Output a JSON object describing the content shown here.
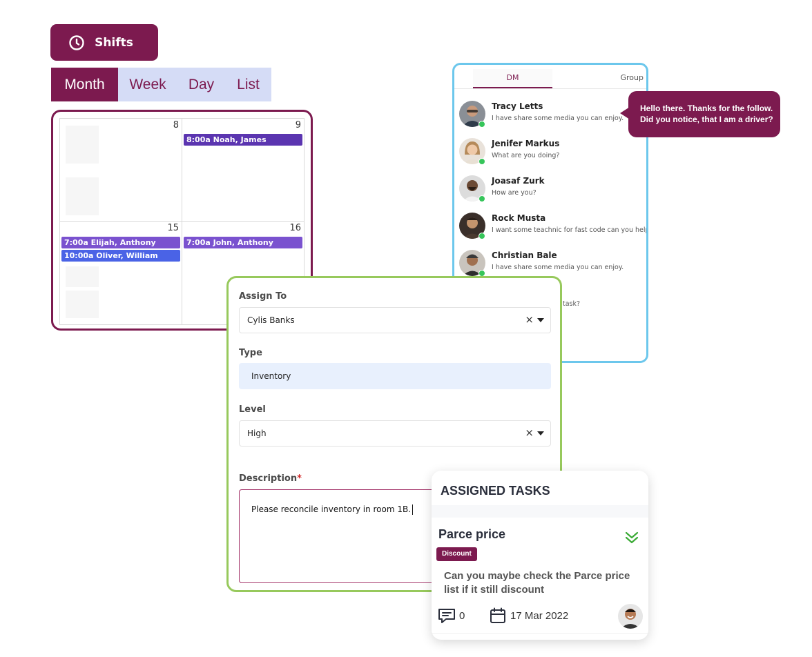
{
  "shifts_button": {
    "label": "Shifts",
    "icon": "clock-icon"
  },
  "view_tabs": [
    {
      "label": "Month",
      "active": true
    },
    {
      "label": "Week",
      "active": false
    },
    {
      "label": "Day",
      "active": false
    },
    {
      "label": "List",
      "active": false
    }
  ],
  "calendar": {
    "days": [
      "8",
      "9",
      "15",
      "16"
    ],
    "events": [
      {
        "label": "8:00a Noah, James",
        "day": "9",
        "color": "#5b35b0"
      },
      {
        "label": "7:00a Elijah, Anthony",
        "day": "15",
        "color": "#7a52cf"
      },
      {
        "label": "10:00a Oliver, William",
        "day": "15",
        "color": "#4a63e6"
      },
      {
        "label": "7:00a John, Anthony",
        "day": "16",
        "color": "#7a52cf"
      }
    ]
  },
  "chat": {
    "tabs": {
      "dm": "DM",
      "group": "Group"
    },
    "contacts": [
      {
        "name": "Tracy Letts",
        "message": "I have share some media you can enjoy."
      },
      {
        "name": "Jenifer Markus",
        "message": "What are you doing?"
      },
      {
        "name": "Joasaf Zurk",
        "message": "How are you?"
      },
      {
        "name": "Rock Musta",
        "message": "I want some teachnic for fast code can you help?"
      },
      {
        "name": "Christian Bale",
        "message": "I have share some media you can enjoy."
      }
    ],
    "partial_message": "task?",
    "bubble": {
      "line1": "Hello there. Thanks for the follow.",
      "line2": "Did you notice, that I am a driver?"
    }
  },
  "form": {
    "assign_label": "Assign To",
    "assign_value": "Cylis Banks",
    "type_label": "Type",
    "type_value": "Inventory",
    "level_label": "Level",
    "level_value": "High",
    "description_label": "Description",
    "required_mark": "*",
    "description_value": "Please reconcile inventory in room 1B.",
    "clear_glyph": "×"
  },
  "tasks": {
    "heading": "ASSIGNED TASKS",
    "task_title": "Parce price",
    "badge": "Discount",
    "description": "Can you maybe check the Parce price list if it still discount",
    "comment_count": "0",
    "date": "17 Mar 2022"
  },
  "colors": {
    "brand": "#7c1a4f",
    "tab_inactive_bg": "#d5dcf6",
    "chat_border": "#6cc7ec",
    "form_border": "#97c95c",
    "online": "#36c55a",
    "chevron": "#3aaa35"
  }
}
